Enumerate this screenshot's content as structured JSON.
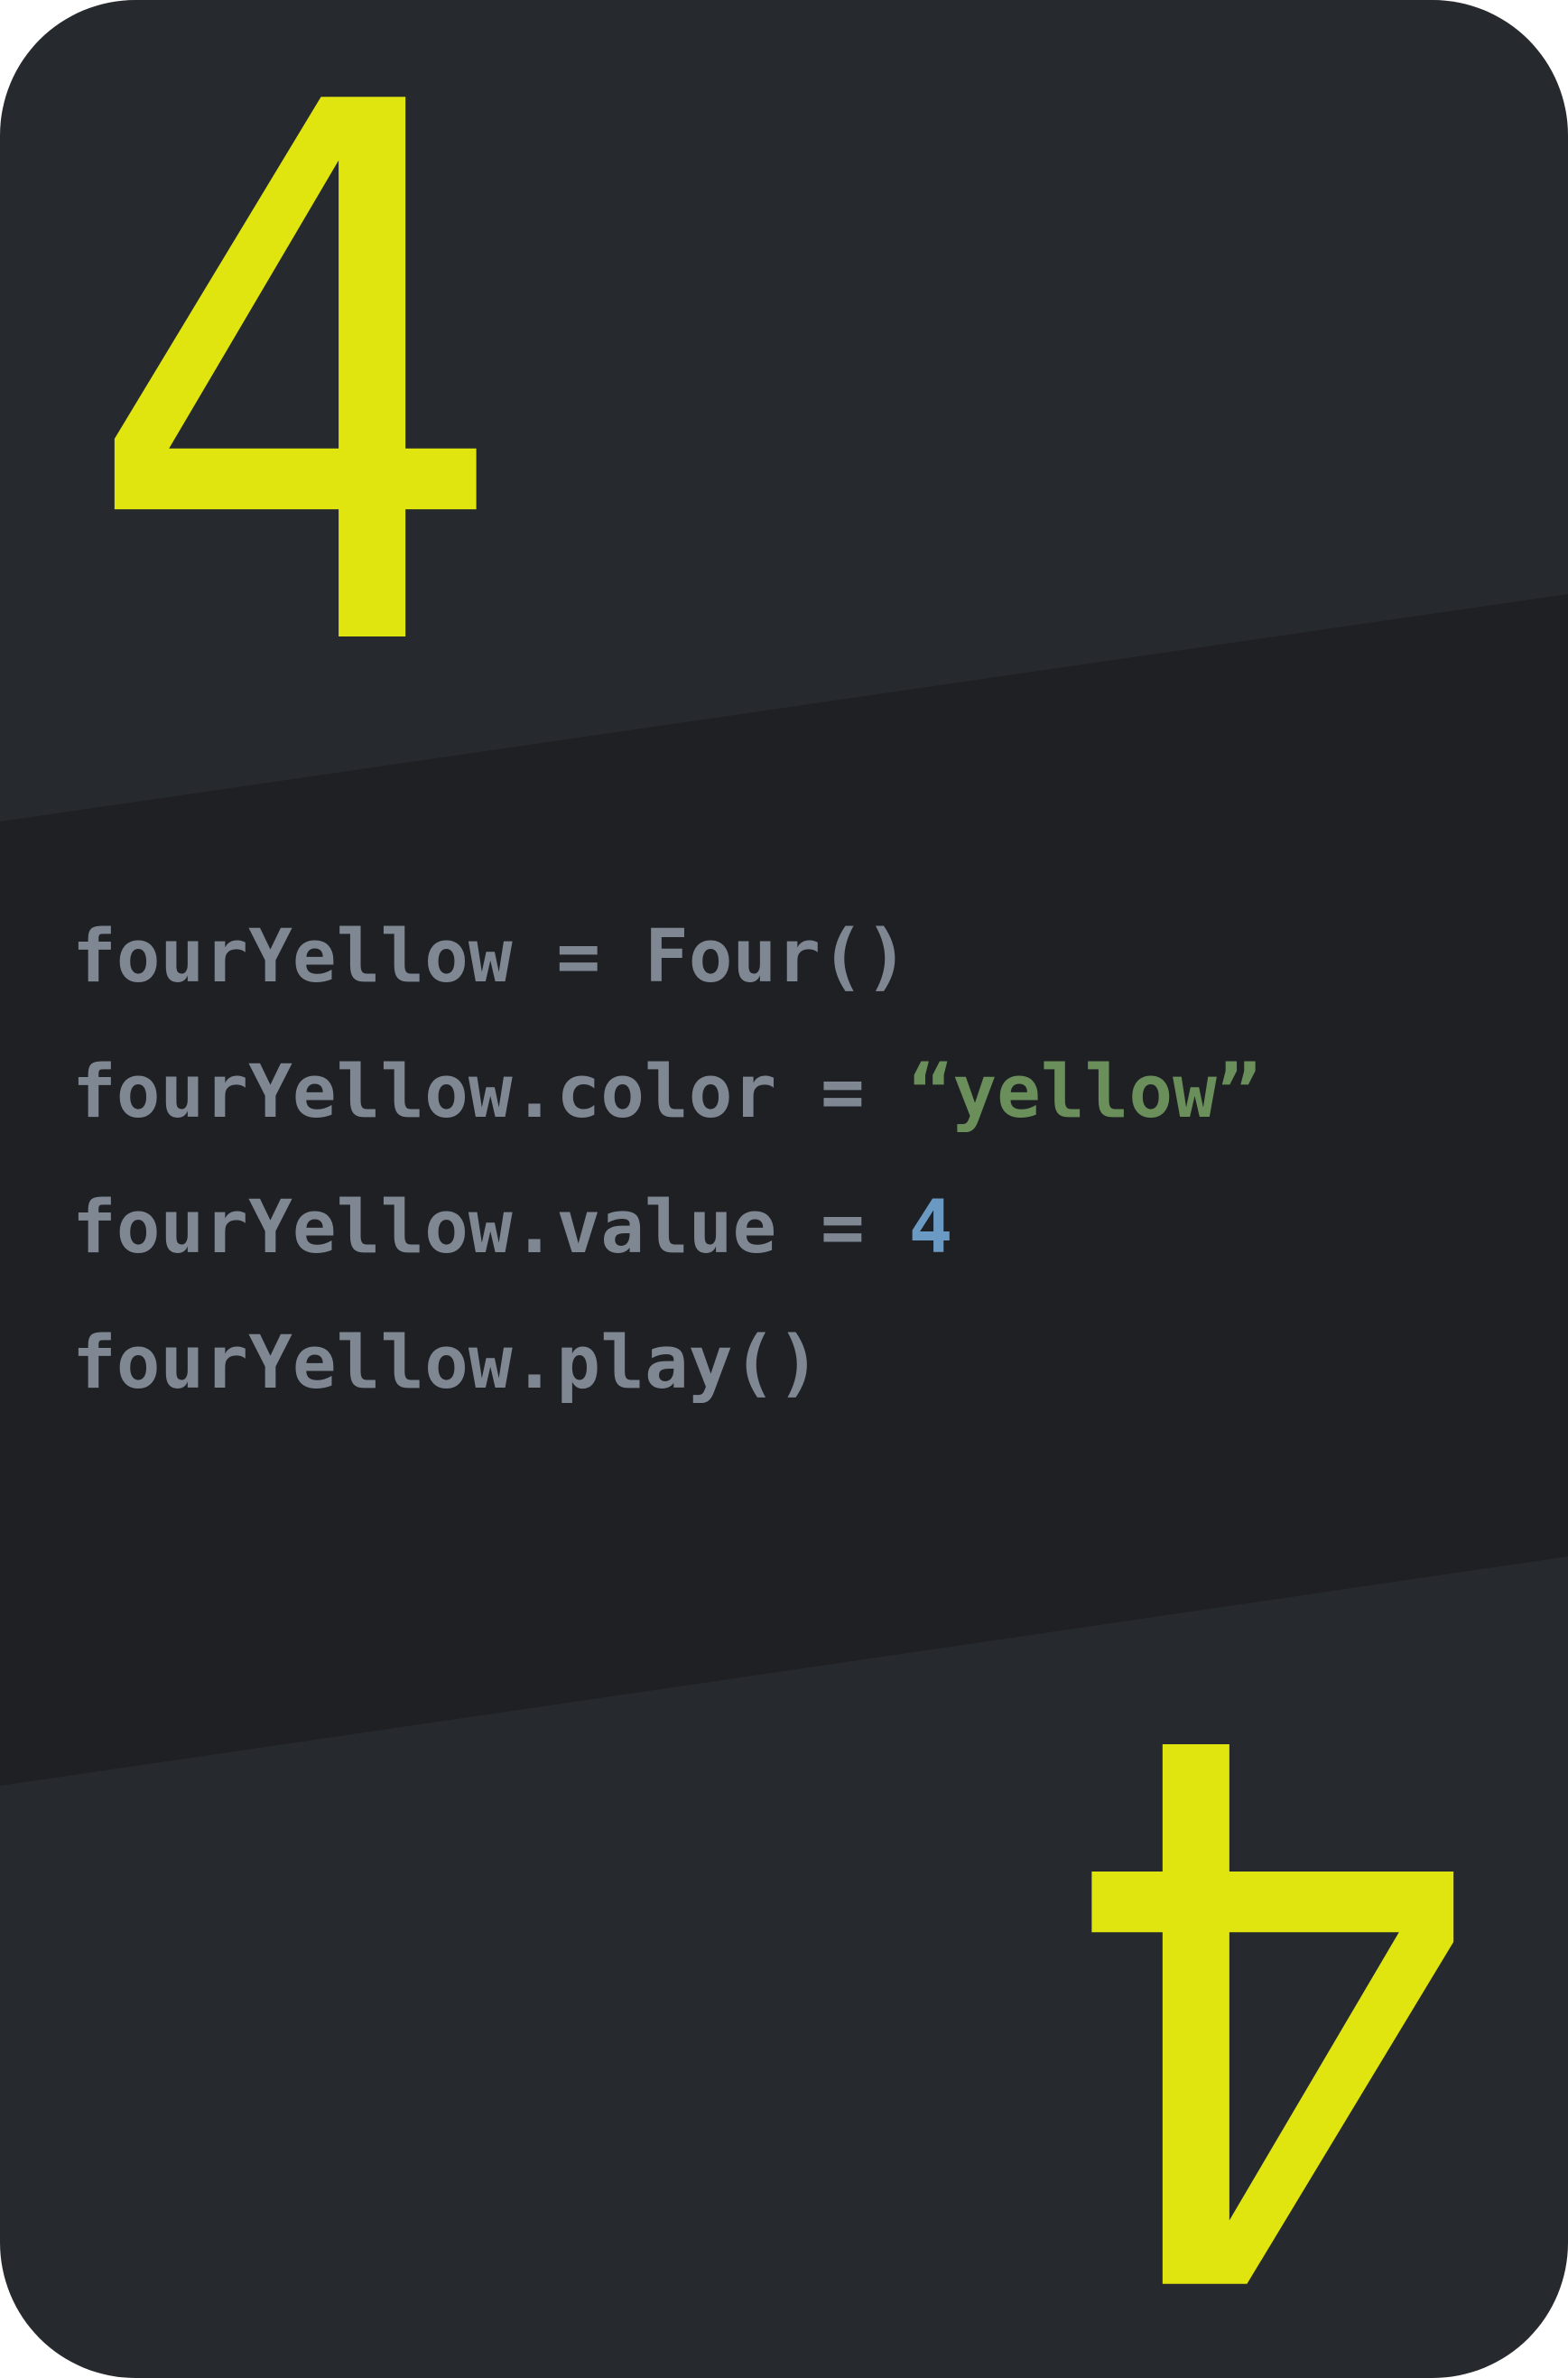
{
  "card": {
    "value": "4",
    "colors": {
      "background": "#26292d",
      "center_band": "#1e2024",
      "accent": "#e0e40f",
      "code_text": "#7f8792",
      "string": "#6a8f5a",
      "number": "#6a9ac4"
    }
  },
  "code": {
    "lines": [
      {
        "tokens": [
          {
            "text": "fourYellow = Four()",
            "kind": "plain"
          }
        ]
      },
      {
        "tokens": [
          {
            "text": "fourYellow.color = ",
            "kind": "plain"
          },
          {
            "text": "“yellow”",
            "kind": "string"
          }
        ]
      },
      {
        "tokens": [
          {
            "text": "fourYellow.value = ",
            "kind": "plain"
          },
          {
            "text": "4",
            "kind": "number"
          }
        ]
      },
      {
        "tokens": [
          {
            "text": "fourYellow.play()",
            "kind": "plain"
          }
        ]
      }
    ]
  }
}
